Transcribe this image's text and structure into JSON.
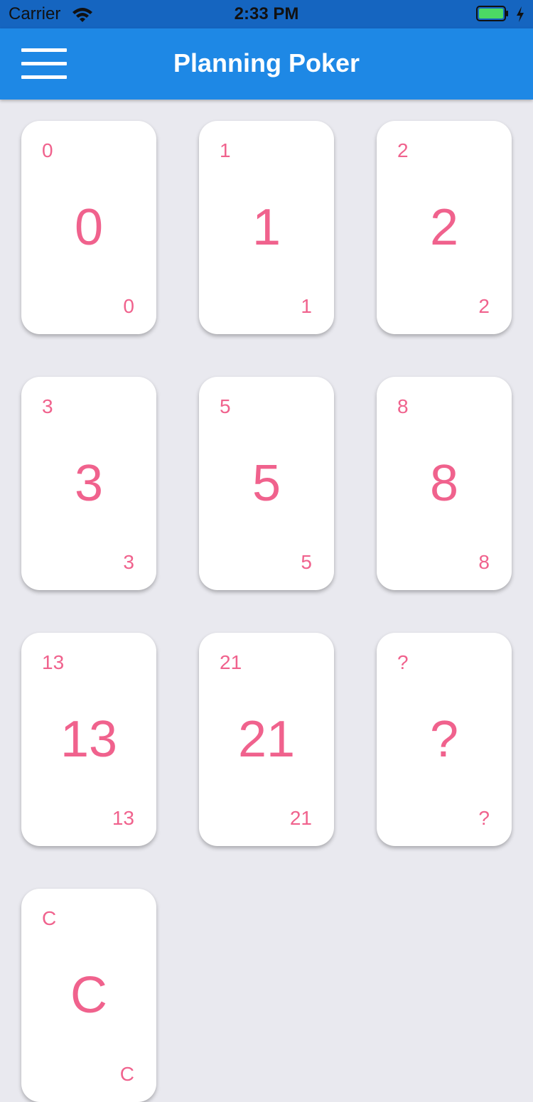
{
  "status_bar": {
    "carrier": "Carrier",
    "time": "2:33 PM",
    "wifi_icon": "wifi-icon",
    "battery_icon": "battery-icon",
    "charging_icon": "bolt-icon",
    "battery_color": "#4cd964"
  },
  "nav": {
    "title": "Planning Poker",
    "menu_icon": "hamburger-menu-icon",
    "background_color": "#1e88e5"
  },
  "theme": {
    "card_text_color": "#f0628d",
    "page_background": "#e9e9ef"
  },
  "cards": [
    {
      "label": "0"
    },
    {
      "label": "1"
    },
    {
      "label": "2"
    },
    {
      "label": "3"
    },
    {
      "label": "5"
    },
    {
      "label": "8"
    },
    {
      "label": "13"
    },
    {
      "label": "21"
    },
    {
      "label": "?"
    },
    {
      "label": "C"
    }
  ]
}
